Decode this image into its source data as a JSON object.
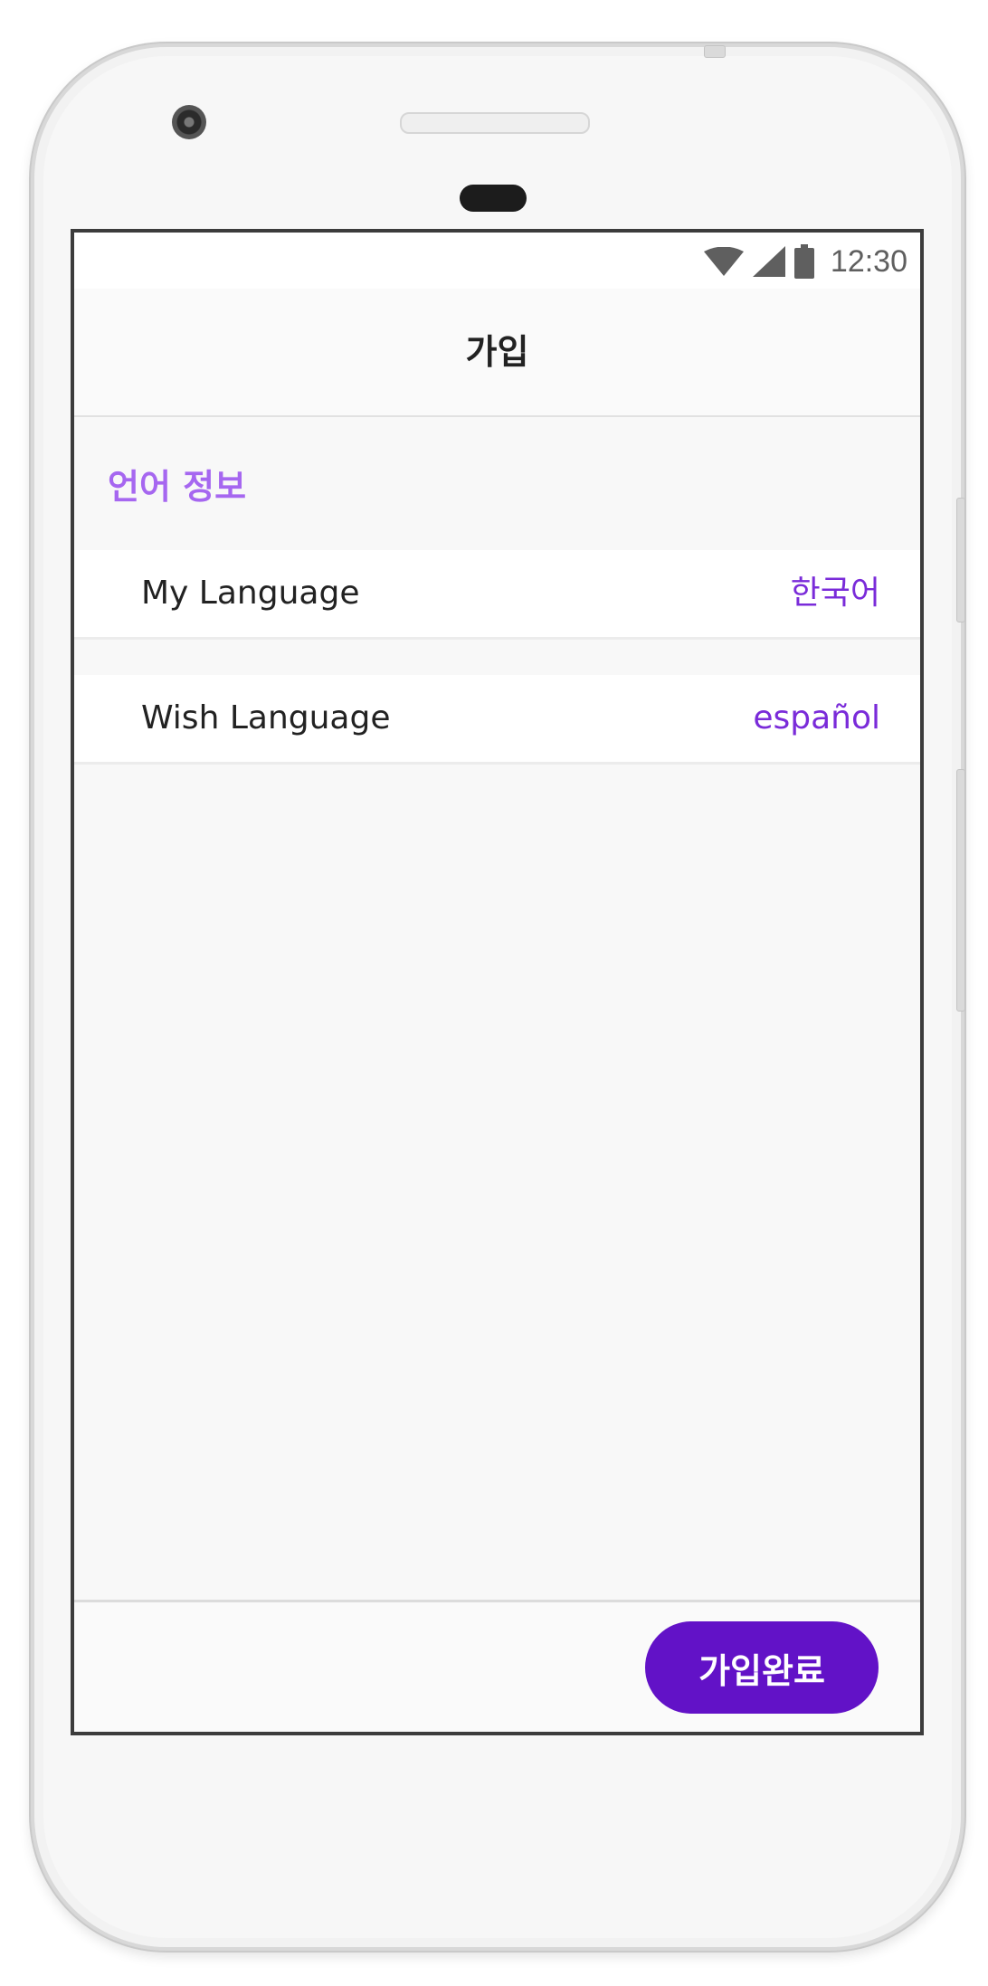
{
  "status_bar": {
    "time": "12:30",
    "icons": [
      "wifi-icon",
      "cell-signal-icon",
      "battery-icon"
    ]
  },
  "app_bar": {
    "title": "가입"
  },
  "section": {
    "title": "언어 정보",
    "rows": [
      {
        "label": "My Language",
        "value": "한국어"
      },
      {
        "label": "Wish Language",
        "value": "español"
      }
    ]
  },
  "footer": {
    "submit_label": "가입완료"
  },
  "colors": {
    "accent": "#6212c7",
    "section_title": "#a667f0",
    "value_text": "#7a2bd9"
  }
}
